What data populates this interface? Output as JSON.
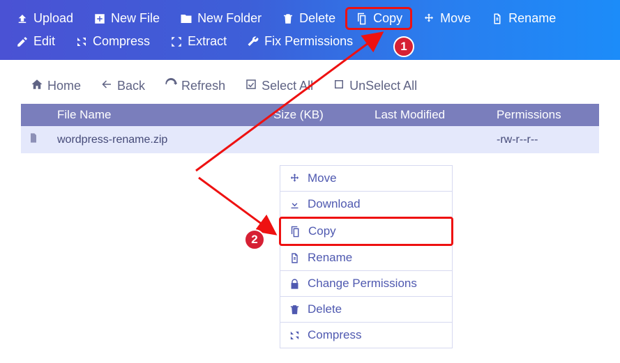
{
  "toolbar": {
    "upload": "Upload",
    "newfile": "New File",
    "newfolder": "New Folder",
    "delete": "Delete",
    "copy": "Copy",
    "move": "Move",
    "rename": "Rename",
    "edit": "Edit",
    "compress": "Compress",
    "extract": "Extract",
    "fixperm": "Fix Permissions"
  },
  "secondbar": {
    "home": "Home",
    "back": "Back",
    "refresh": "Refresh",
    "selectall": "Select All",
    "unselectall": "UnSelect All"
  },
  "table": {
    "headers": {
      "name": "File Name",
      "size": "Size (KB)",
      "modified": "Last Modified",
      "perm": "Permissions"
    },
    "rows": [
      {
        "name": "wordpress-rename.zip",
        "size": "",
        "modified": "",
        "perm": "-rw-r--r--"
      }
    ]
  },
  "context_menu": {
    "move": "Move",
    "download": "Download",
    "copy": "Copy",
    "rename": "Rename",
    "changeperm": "Change Permissions",
    "delete": "Delete",
    "compress": "Compress"
  },
  "annotations": {
    "badge1": "1",
    "badge2": "2"
  }
}
